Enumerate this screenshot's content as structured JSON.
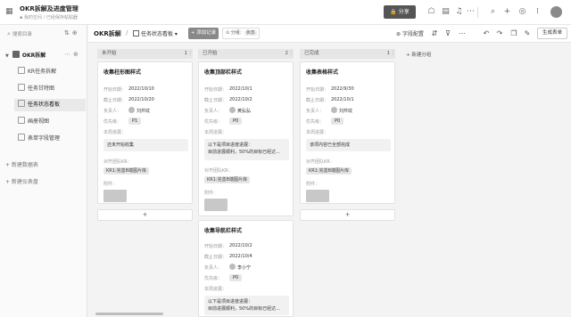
{
  "header": {
    "title": "OKR拆解及进度管理",
    "breadcrumb": "我的空间 / 已经保存粘贴器",
    "share_label": "分享"
  },
  "sidebar": {
    "search_label": "搜索目录",
    "root_label": "OKR拆解",
    "items": [
      {
        "label": "KR任务拆解"
      },
      {
        "label": "任务甘特图"
      },
      {
        "label": "任务状态看板"
      },
      {
        "label": "画册视图"
      },
      {
        "label": "表单字段管理"
      }
    ],
    "new_table": "+ 新建数据表",
    "new_dashboard": "+ 新建仪表盘"
  },
  "viewbar": {
    "table_title": "OKR拆解",
    "view_name": "任务状态看板",
    "add_record": "+ 添加记录",
    "group_label": "分组：",
    "group_value": "状态",
    "field_config": "字段配置",
    "generate_form": "生成表单"
  },
  "columns": [
    {
      "name": "未开始",
      "count": "1"
    },
    {
      "name": "已开始",
      "count": "2"
    },
    {
      "name": "已完成",
      "count": "1"
    }
  ],
  "new_group": "+ 新建分组",
  "field_labels": {
    "start": "开始日期：",
    "end": "截止日期：",
    "owner": "负责人：",
    "priority": "优先级：",
    "desc": "本周进展：",
    "kr": "对齐团队KR：",
    "attach": "附件："
  },
  "cards": [
    {
      "title": "收集柱形图样式",
      "start": "2022/10/10",
      "end": "2022/10/20",
      "owner": "刘芹纹",
      "priority": "P1",
      "desc": [
        "还未开始收集"
      ],
      "kr": "KR1:完善B端图片库"
    },
    {
      "title": "收集顶部栏样式",
      "start": "2022/10/1",
      "end": "2022/10/2",
      "owner": "黄弘弘",
      "priority": "P0",
      "desc": [
        "以下是项目进度进展：",
        "目前进展顺利，50%的目标已经达..."
      ],
      "kr": "KR1:完善B端图片库"
    },
    {
      "title": "收集导航栏样式",
      "start": "2022/10/2",
      "end": "2022/10/4",
      "owner": "李小宁",
      "priority": "P0",
      "desc": [
        "以下是项目进度进展：",
        "目前进展顺利，50%的目标已经达..."
      ]
    },
    {
      "title": "收集表格样式",
      "start": "2022/9/30",
      "end": "2022/10/1",
      "owner": "刘芹纹",
      "priority": "P0",
      "desc": [
        "该项内容已全部完成"
      ],
      "kr": "KR1:完善B端图片库"
    }
  ]
}
